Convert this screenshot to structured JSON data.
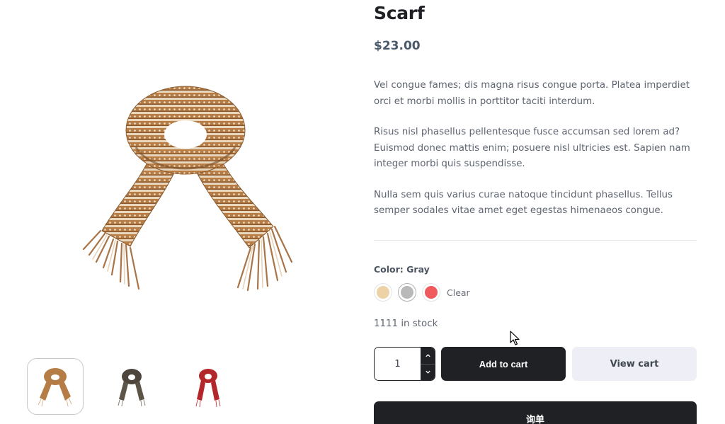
{
  "product": {
    "title": "Scarf",
    "price": "$23.00",
    "description": [
      "Vel congue fames; dis magna risus congue porta. Platea imperdiet orci et morbi mollis in porttitor taciti interdum.",
      "Risus nisl phasellus pellentesque fusce accumsan sed lorem ad? Euismod donec mattis enim; posuere nisl ultricies est. Sapien nam integer morbi quis suspendisse.",
      "Nulla sem quis varius curae natoque tincidunt phasellus. Tellus semper sodales vitae amet eget egestas himenaeos congue."
    ],
    "stock": "1111 in stock"
  },
  "gallery": {
    "main_image": "scarf-brown-image",
    "thumbnails": [
      {
        "name": "scarf-brown-thumbnail",
        "color": "#b57c46",
        "active": true
      },
      {
        "name": "scarf-dark-plaid-thumbnail",
        "color": "#4e463c",
        "active": false
      },
      {
        "name": "scarf-red-thumbnail",
        "color": "#b3262a",
        "active": false
      }
    ]
  },
  "variation": {
    "color_label": "Color: Gray",
    "swatches": [
      {
        "name": "beige",
        "hex": "#ecd2a6",
        "selected": false
      },
      {
        "name": "gray",
        "hex": "#b9b9b9",
        "selected": true
      },
      {
        "name": "red",
        "hex": "#ee5a5e",
        "selected": false
      }
    ],
    "clear_label": "Clear"
  },
  "cart": {
    "quantity": "1",
    "add_to_cart_label": "Add to cart",
    "view_cart_label": "View cart",
    "inquiry_label": "询单"
  },
  "colors": {
    "primary_dark": "#1f2124",
    "price_text": "#4b5a6a",
    "view_cart_bg": "#edeef6"
  }
}
